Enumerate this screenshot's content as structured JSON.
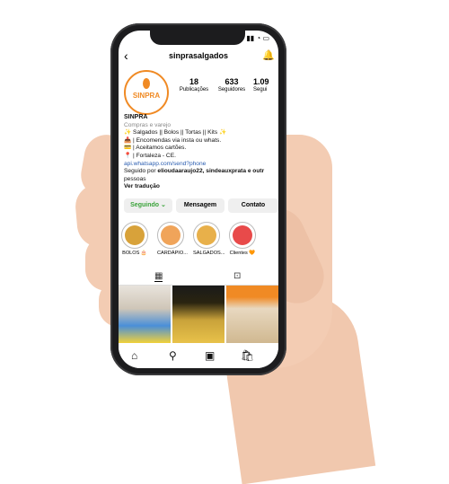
{
  "app": {
    "status_time": "",
    "status_right": "▮▮ ◔ ▭",
    "username": "sinprasalgados"
  },
  "profile": {
    "avatar_text": "SINPRA",
    "stats": [
      {
        "value": "18",
        "label": "Publicações"
      },
      {
        "value": "633",
        "label": "Seguidores"
      },
      {
        "value": "1.09",
        "label": "Segui"
      }
    ],
    "name": "SINPRA",
    "category": "Compras e varejo",
    "bio_lines": [
      "✨ Salgados || Bolos || Tortas || Kits ✨",
      "📥 | Encomendas via insta ou whats.",
      "💳 | Aceitamos cartões.",
      "📍 | Fortaleza - CE."
    ],
    "link": "api.whatsapp.com/send?phone",
    "followed_by_prefix": "Seguido por ",
    "followed_by_names": "elioudaaraujo22, sindeauxprata e outr",
    "followed_by_suffix": "pessoas",
    "translate": "Ver tradução"
  },
  "buttons": {
    "follow": "Seguindo ⌄",
    "message": "Mensagem",
    "contact": "Contato"
  },
  "highlights": [
    {
      "label": "BOLOS 🎂",
      "color": "#d8a23a"
    },
    {
      "label": "CARDÁPIO...",
      "color": "#f0a45a"
    },
    {
      "label": "SALGADOS...",
      "color": "#e8b04a"
    },
    {
      "label": "Clientes 🧡",
      "color": "#e84a4a"
    }
  ],
  "colors": {
    "accent": "#f08a24",
    "follow_text": "#3aa33a",
    "link": "#2a5db0"
  },
  "icons": {
    "back": "‹",
    "bell": "🔔",
    "grid": "▦",
    "tagged": "⊡",
    "home": "⌂",
    "search": "⚲",
    "reels": "▣",
    "shop": "🛍"
  }
}
